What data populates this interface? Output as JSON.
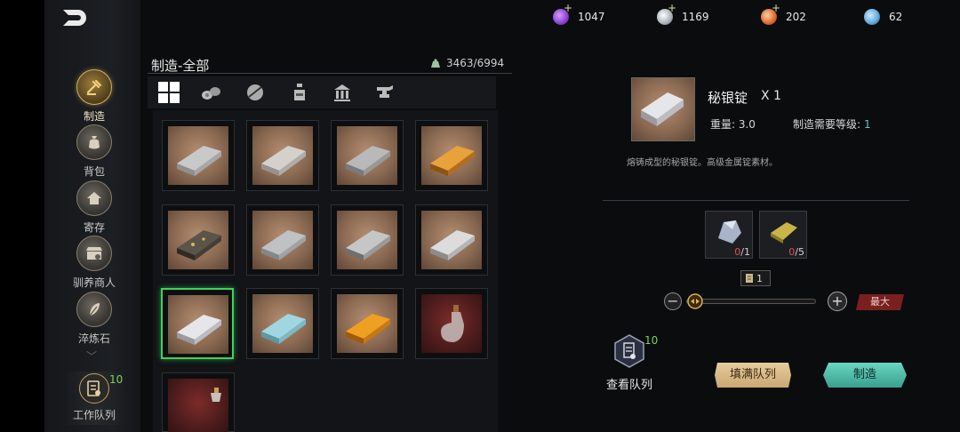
{
  "header": {
    "currencies": [
      {
        "icon": "purple-gem-icon",
        "value": "1047",
        "color": "#8a3fd1",
        "has_plus": true
      },
      {
        "icon": "silver-coin-icon",
        "value": "1169",
        "color": "#a9b0b8",
        "has_plus": true
      },
      {
        "icon": "orange-coin-icon",
        "value": "202",
        "color": "#d8692e",
        "has_plus": true
      },
      {
        "icon": "blue-crystal-icon",
        "value": "62",
        "color": "#5ea6d8",
        "has_plus": false
      }
    ]
  },
  "sidebar": {
    "items": [
      {
        "label": "制造",
        "icon": "hammer-icon",
        "active": true
      },
      {
        "label": "背包",
        "icon": "bag-icon",
        "active": false
      },
      {
        "label": "寄存",
        "icon": "house-icon",
        "active": false
      },
      {
        "label": "驯养商人",
        "icon": "merchant-icon",
        "active": false
      },
      {
        "label": "淬炼石",
        "icon": "feather-stone-icon",
        "active": false
      }
    ],
    "queue": {
      "label": "工作队列",
      "count": "10",
      "icon": "queue-icon"
    }
  },
  "panel": {
    "title": "制造-全部",
    "weight": "3463/6994",
    "categories": [
      "all-grid-icon",
      "logs-icon",
      "ore-icon",
      "potion-icon",
      "building-icon",
      "anvil-icon"
    ],
    "items": [
      {
        "name": "silver-ingot",
        "kind": "ingot",
        "color": "#c9c9c9"
      },
      {
        "name": "silver-ingot-2",
        "kind": "ingot",
        "color": "#d4d0cc"
      },
      {
        "name": "iron-ingot",
        "kind": "ingot",
        "color": "#b9b9b9"
      },
      {
        "name": "copper-ingot",
        "kind": "ingot",
        "color": "#d9922e"
      },
      {
        "name": "black-ingot",
        "kind": "ingot",
        "color": "#5b5448"
      },
      {
        "name": "steel-ingot",
        "kind": "ingot",
        "color": "#bfc1c3"
      },
      {
        "name": "fine-steel-ingot",
        "kind": "ingot",
        "color": "#c6c6c6"
      },
      {
        "name": "white-steel-ingot",
        "kind": "ingot",
        "color": "#dcdcdc"
      },
      {
        "name": "mithril-ingot",
        "kind": "ingot",
        "color": "#e6e6ea"
      },
      {
        "name": "crystal-ingot",
        "kind": "ingot",
        "color": "#9fd6e0"
      },
      {
        "name": "gold-ingot",
        "kind": "ingot",
        "color": "#f0a020"
      },
      {
        "name": "bottle",
        "kind": "bottle",
        "color": "#c8c0bc"
      },
      {
        "name": "bottle-2",
        "kind": "bottle",
        "color": "#c8c0bc"
      }
    ]
  },
  "detail": {
    "name": "秘银锭",
    "quantity": "X 1",
    "weight": "重量: 3.0",
    "level_label": "制造需要等级:",
    "level_value": "1",
    "description": "熔铸成型的秘银锭。高级金属锭素材。",
    "materials": [
      {
        "name": "silver-ore",
        "have": "0",
        "need": "/1",
        "color": "#a9b4c8"
      },
      {
        "name": "gold-ore",
        "have": "0",
        "need": "/5",
        "color": "#c9b44a"
      }
    ],
    "craft_count": "1",
    "slider_fraction": 0,
    "max_label": "最大",
    "view_queue_label": "查看队列",
    "view_queue_count": "10",
    "fill_queue_label": "填满队列",
    "craft_label": "制造"
  }
}
